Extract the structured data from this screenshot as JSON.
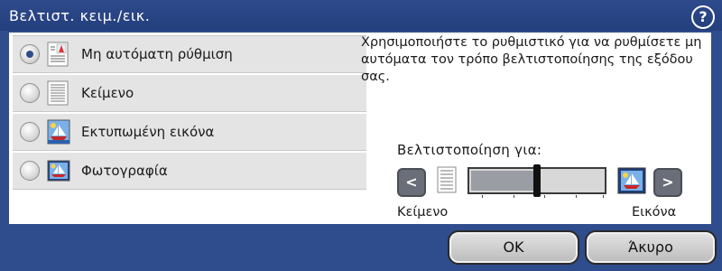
{
  "window": {
    "title": "Βελτιστ. κειμ./εικ."
  },
  "help": {
    "label": "?"
  },
  "options": [
    {
      "label": "Μη αυτόματη ρύθμιση",
      "checked": true,
      "icon": "manual-adjust-icon"
    },
    {
      "label": "Κείμενο",
      "checked": false,
      "icon": "text-document-icon"
    },
    {
      "label": "Εκτυπωμένη εικόνα",
      "checked": false,
      "icon": "printed-picture-icon"
    },
    {
      "label": "Φωτογραφία",
      "checked": false,
      "icon": "photograph-icon"
    }
  ],
  "description": "Χρησιμοποιήστε το ρυθμιστικό για να ρυθμίσετε μη αυτόματα τον τρόπο βελτιστοποίησης της εξόδου σας.",
  "optimize": {
    "heading": "Βελτιστοποίηση για:",
    "left_label": "Κείμενο",
    "right_label": "Εικόνα",
    "slider_value": 0.5,
    "left_arrow": "<",
    "right_arrow": ">"
  },
  "footer": {
    "ok_label": "OK",
    "cancel_label": "Άκυρο"
  },
  "colors": {
    "accent": "#2f4c8c",
    "panel": "#ffffff",
    "option_bg": "#e4e4e4"
  }
}
